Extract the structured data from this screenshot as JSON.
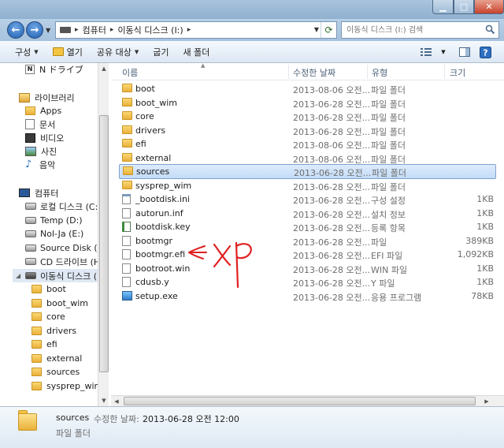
{
  "nav": {
    "address_parts": [
      "컴퓨터",
      "이동식 디스크 (I:)"
    ],
    "search_placeholder": "이동식 디스크 (I:) 검색"
  },
  "toolbar": {
    "organize": "구성",
    "open": "열기",
    "share": "공유 대상",
    "burn": "굽기",
    "new_folder": "새 폴더"
  },
  "navpane": {
    "top_item": "N ドライブ",
    "libraries": "라이브러리",
    "apps": "Apps",
    "documents": "문서",
    "videos": "비디오",
    "pictures": "사진",
    "music": "음악",
    "computer": "컴퓨터",
    "drives": [
      {
        "label": "로컬 디스크 (C:)"
      },
      {
        "label": "Temp (D:)"
      },
      {
        "label": "Nol-Ja (E:)"
      },
      {
        "label": "Source Disk (F:)"
      },
      {
        "label": "CD 드라이브 (H:)"
      },
      {
        "label": "이동식 디스크 (I:)"
      }
    ],
    "subfolders": [
      "boot",
      "boot_wim",
      "core",
      "drivers",
      "efi",
      "external",
      "sources",
      "sysprep_wim"
    ]
  },
  "columns": {
    "name": "이름",
    "date": "수정한 날짜",
    "type": "유형",
    "size": "크기"
  },
  "files": [
    {
      "name": "boot",
      "date": "2013-08-06 오전...",
      "type": "파일 폴더",
      "size": "",
      "icon": "folder-icon"
    },
    {
      "name": "boot_wim",
      "date": "2013-06-28 오전...",
      "type": "파일 폴더",
      "size": "",
      "icon": "folder-icon"
    },
    {
      "name": "core",
      "date": "2013-06-28 오전...",
      "type": "파일 폴더",
      "size": "",
      "icon": "folder-icon"
    },
    {
      "name": "drivers",
      "date": "2013-06-28 오전...",
      "type": "파일 폴더",
      "size": "",
      "icon": "folder-icon"
    },
    {
      "name": "efi",
      "date": "2013-08-06 오전...",
      "type": "파일 폴더",
      "size": "",
      "icon": "folder-icon"
    },
    {
      "name": "external",
      "date": "2013-08-06 오전...",
      "type": "파일 폴더",
      "size": "",
      "icon": "folder-icon"
    },
    {
      "name": "sources",
      "date": "2013-06-28 오전...",
      "type": "파일 폴더",
      "size": "",
      "icon": "folder-icon"
    },
    {
      "name": "sysprep_wim",
      "date": "2013-06-28 오전...",
      "type": "파일 폴더",
      "size": "",
      "icon": "folder-icon"
    },
    {
      "name": "_bootdisk.ini",
      "date": "2013-06-28 오전...",
      "type": "구성 설정",
      "size": "1KB",
      "icon": "ini-file-icon"
    },
    {
      "name": "autorun.inf",
      "date": "2013-06-28 오전...",
      "type": "설치 정보",
      "size": "1KB",
      "icon": "file-icon"
    },
    {
      "name": "bootdisk.key",
      "date": "2013-06-28 오전...",
      "type": "등록 항목",
      "size": "1KB",
      "icon": "registry-file-icon"
    },
    {
      "name": "bootmgr",
      "date": "2013-06-28 오전...",
      "type": "파일",
      "size": "389KB",
      "icon": "file-icon"
    },
    {
      "name": "bootmgr.efi",
      "date": "2013-06-28 오전...",
      "type": "EFI 파일",
      "size": "1,092KB",
      "icon": "file-icon"
    },
    {
      "name": "bootroot.win",
      "date": "2013-06-28 오전...",
      "type": "WIN 파일",
      "size": "1KB",
      "icon": "file-icon"
    },
    {
      "name": "cdusb.y",
      "date": "2013-06-28 오전...",
      "type": "Y 파일",
      "size": "1KB",
      "icon": "file-icon"
    },
    {
      "name": "setup.exe",
      "date": "2013-06-28 오전...",
      "type": "응용 프로그램",
      "size": "78KB",
      "icon": "exe-icon"
    }
  ],
  "selected_file": "sources",
  "status": {
    "name": "sources",
    "date_label": "수정한 날짜:",
    "date_value": "2013-06-28 오전 12:00",
    "type": "파일 폴더"
  },
  "annotation": {
    "text": "XP",
    "color": "#e02020"
  }
}
